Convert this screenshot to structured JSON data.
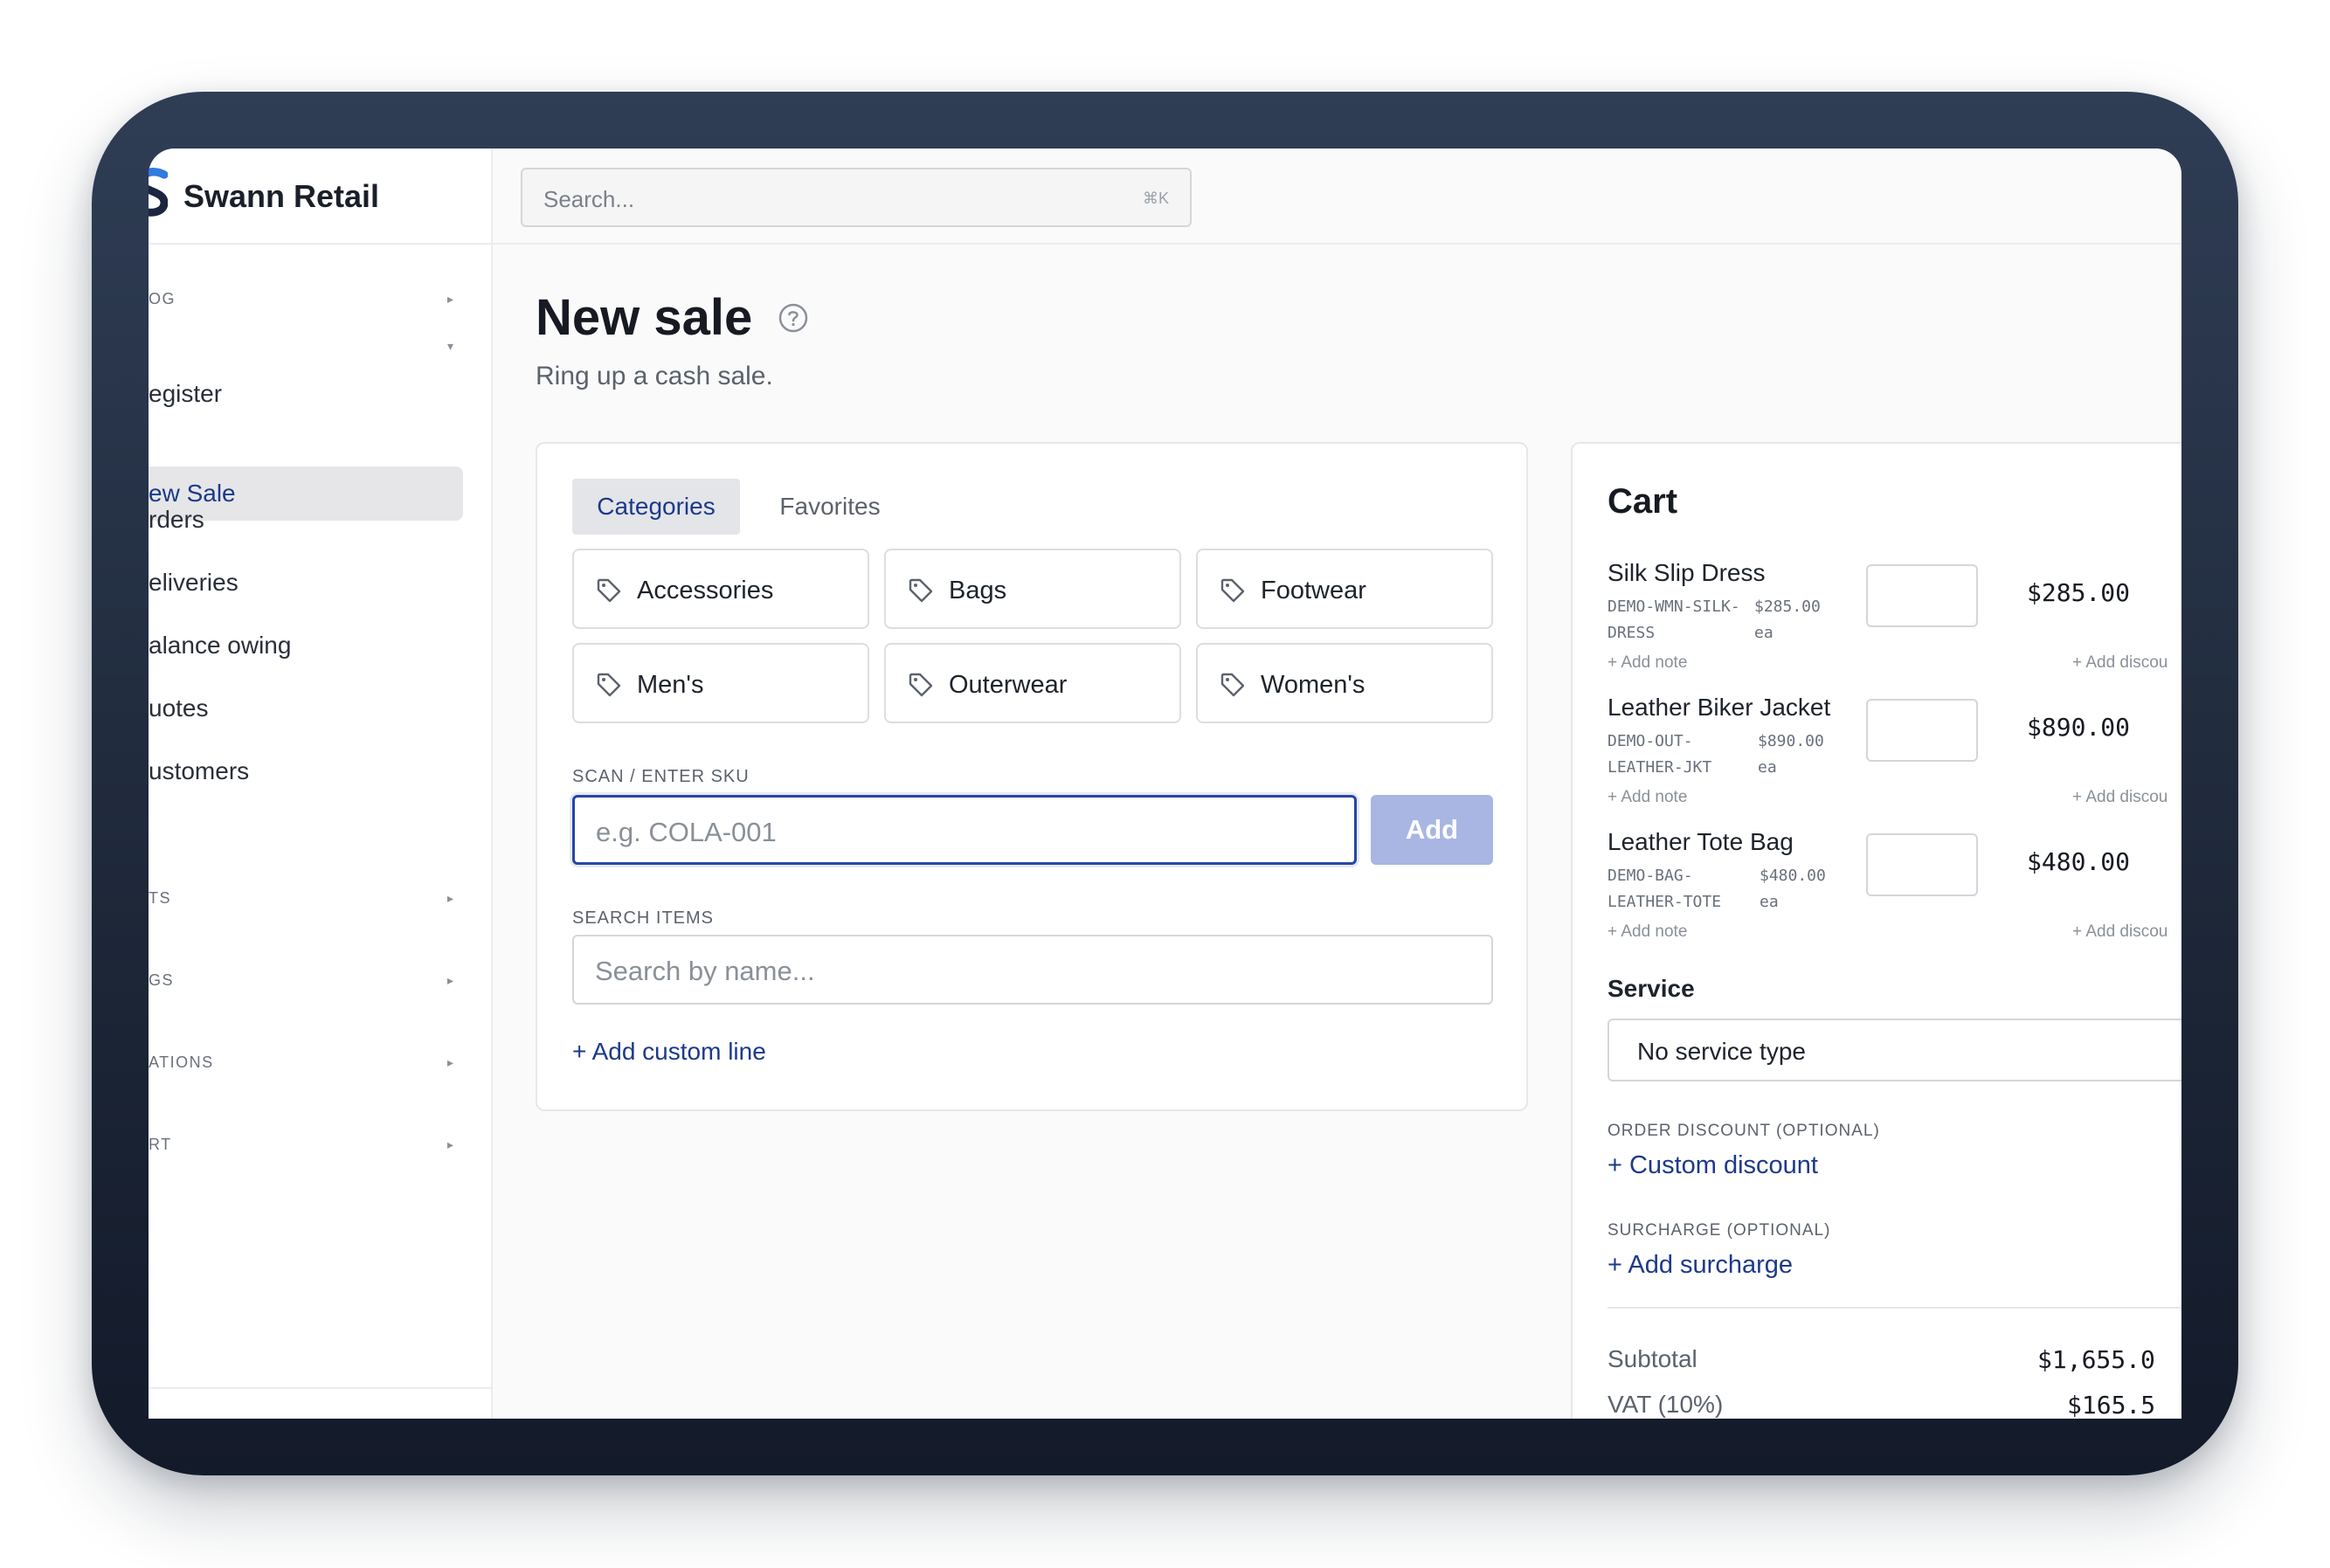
{
  "app": {
    "name": "Swann Retail"
  },
  "search": {
    "placeholder": "Search...",
    "shortcut": "⌘K"
  },
  "sidebar": {
    "sections": [
      {
        "label": "OG",
        "collapsed": true
      },
      {
        "label": "",
        "collapsed": false
      },
      {
        "label": "TS",
        "collapsed": true
      },
      {
        "label": "GS",
        "collapsed": true
      },
      {
        "label": "ATIONS",
        "collapsed": true
      },
      {
        "label": "RT",
        "collapsed": true
      }
    ],
    "items": [
      {
        "label": "egister"
      },
      {
        "label": "ew Sale",
        "active": true
      },
      {
        "label": "rders"
      },
      {
        "label": "eliveries"
      },
      {
        "label": "alance owing"
      },
      {
        "label": "uotes"
      },
      {
        "label": "ustomers"
      }
    ],
    "footer": ""
  },
  "page": {
    "title": "New sale",
    "subtitle": "Ring up a cash sale."
  },
  "tabs": [
    {
      "label": "Categories",
      "active": true
    },
    {
      "label": "Favorites",
      "active": false
    }
  ],
  "categories": [
    {
      "label": "Accessories"
    },
    {
      "label": "Bags"
    },
    {
      "label": "Footwear"
    },
    {
      "label": "Men's"
    },
    {
      "label": "Outerwear"
    },
    {
      "label": "Women's"
    }
  ],
  "sku": {
    "label": "SCAN / ENTER SKU",
    "placeholder": "e.g. COLA-001",
    "add_label": "Add"
  },
  "search_items": {
    "label": "SEARCH ITEMS",
    "placeholder": "Search by name..."
  },
  "custom_line": "+ Add custom line",
  "cart": {
    "title": "Cart",
    "items": [
      {
        "name": "Silk Slip Dress",
        "sku_line1": "DEMO-WMN-SILK-",
        "sku_line2": "DRESS",
        "each_price": "$285.00",
        "each_unit": "ea",
        "total": "$285.00",
        "note": "+ Add note",
        "discount": "+ Add discou"
      },
      {
        "name": "Leather Biker Jacket",
        "sku_line1": "DEMO-OUT-",
        "sku_line2": "LEATHER-JKT",
        "each_price": "$890.00",
        "each_unit": "ea",
        "total": "$890.00",
        "note": "+ Add note",
        "discount": "+ Add discou"
      },
      {
        "name": "Leather Tote Bag",
        "sku_line1": "DEMO-BAG-",
        "sku_line2": "LEATHER-TOTE",
        "each_price": "$480.00",
        "each_unit": "ea",
        "total": "$480.00",
        "note": "+ Add note",
        "discount": "+ Add discou"
      }
    ],
    "service": {
      "label": "Service",
      "value": "No service type"
    },
    "order_discount": {
      "label": "ORDER DISCOUNT (OPTIONAL)",
      "link": "+ Custom discount"
    },
    "surcharge": {
      "label": "SURCHARGE (OPTIONAL)",
      "link": "+ Add surcharge"
    },
    "subtotal": {
      "label": "Subtotal",
      "value": "$1,655.0"
    },
    "vat": {
      "label": "VAT (10%)",
      "value": "$165.5"
    }
  },
  "colors": {
    "accent": "#1c3a8a",
    "focus_border": "#2647a6",
    "add_button": "#a9b6e3",
    "device_frame": "#1d2738"
  }
}
